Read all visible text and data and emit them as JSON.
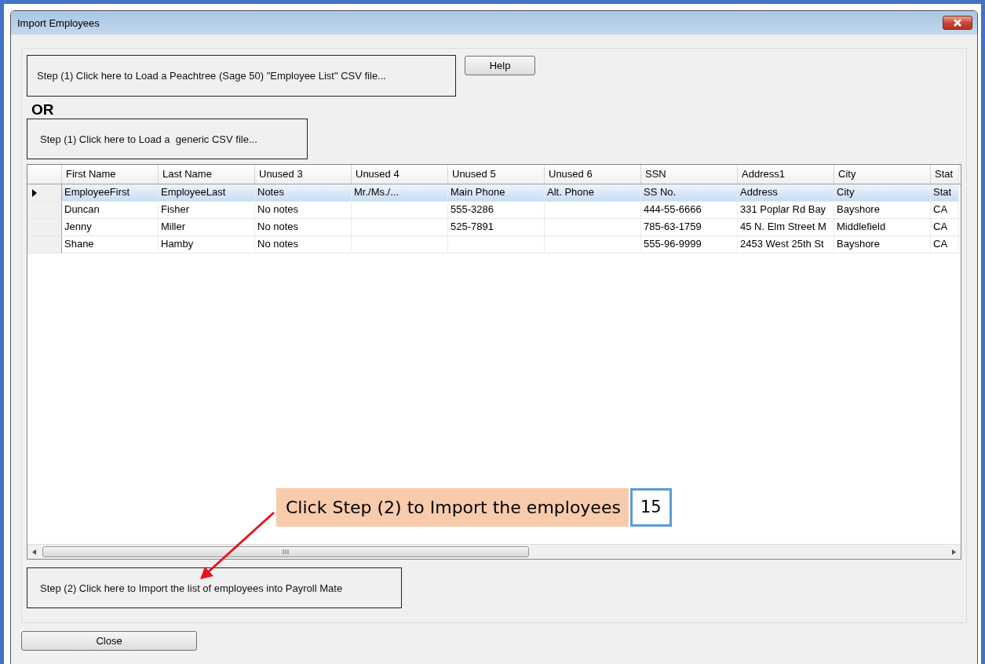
{
  "window": {
    "title": "Import Employees"
  },
  "load_peachtree_button": "Step (1) Click here to Load a Peachtree (Sage 50) \"Employee List\" CSV file...",
  "help_button": "Help",
  "or_label": "OR",
  "load_generic_button": "Step (1) Click here to Load a  generic CSV file...",
  "table": {
    "columns": [
      "First Name",
      "Last Name",
      "Unused 3",
      "Unused 4",
      "Unused 5",
      "Unused 6",
      "SSN",
      "Address1",
      "City",
      "Stat"
    ],
    "rows": [
      {
        "selected": true,
        "cells": [
          "EmployeeFirst",
          "EmployeeLast",
          "Notes",
          "Mr./Ms./...",
          "Main Phone",
          "Alt. Phone",
          "SS No.",
          "Address",
          "City",
          "Stat"
        ]
      },
      {
        "selected": false,
        "cells": [
          "Duncan",
          "Fisher",
          "No notes",
          "",
          "555-3286",
          "",
          "444-55-6666",
          "331 Poplar Rd Bay",
          "Bayshore",
          "CA"
        ]
      },
      {
        "selected": false,
        "cells": [
          "Jenny",
          "Miller",
          "No notes",
          "",
          "525-7891",
          "",
          "785-63-1759",
          "45 N. Elm Street M",
          "Middlefield",
          "CA"
        ]
      },
      {
        "selected": false,
        "cells": [
          "Shane",
          "Hamby",
          "No notes",
          "",
          "",
          "",
          "555-96-9999",
          "2453 West 25th St",
          "Bayshore",
          "CA"
        ]
      }
    ]
  },
  "callout": {
    "text": "Click Step (2) to Import the employees",
    "step_number": "15"
  },
  "import_button": "Step (2) Click here to Import the list of employees into Payroll Mate",
  "close_button": "Close"
}
